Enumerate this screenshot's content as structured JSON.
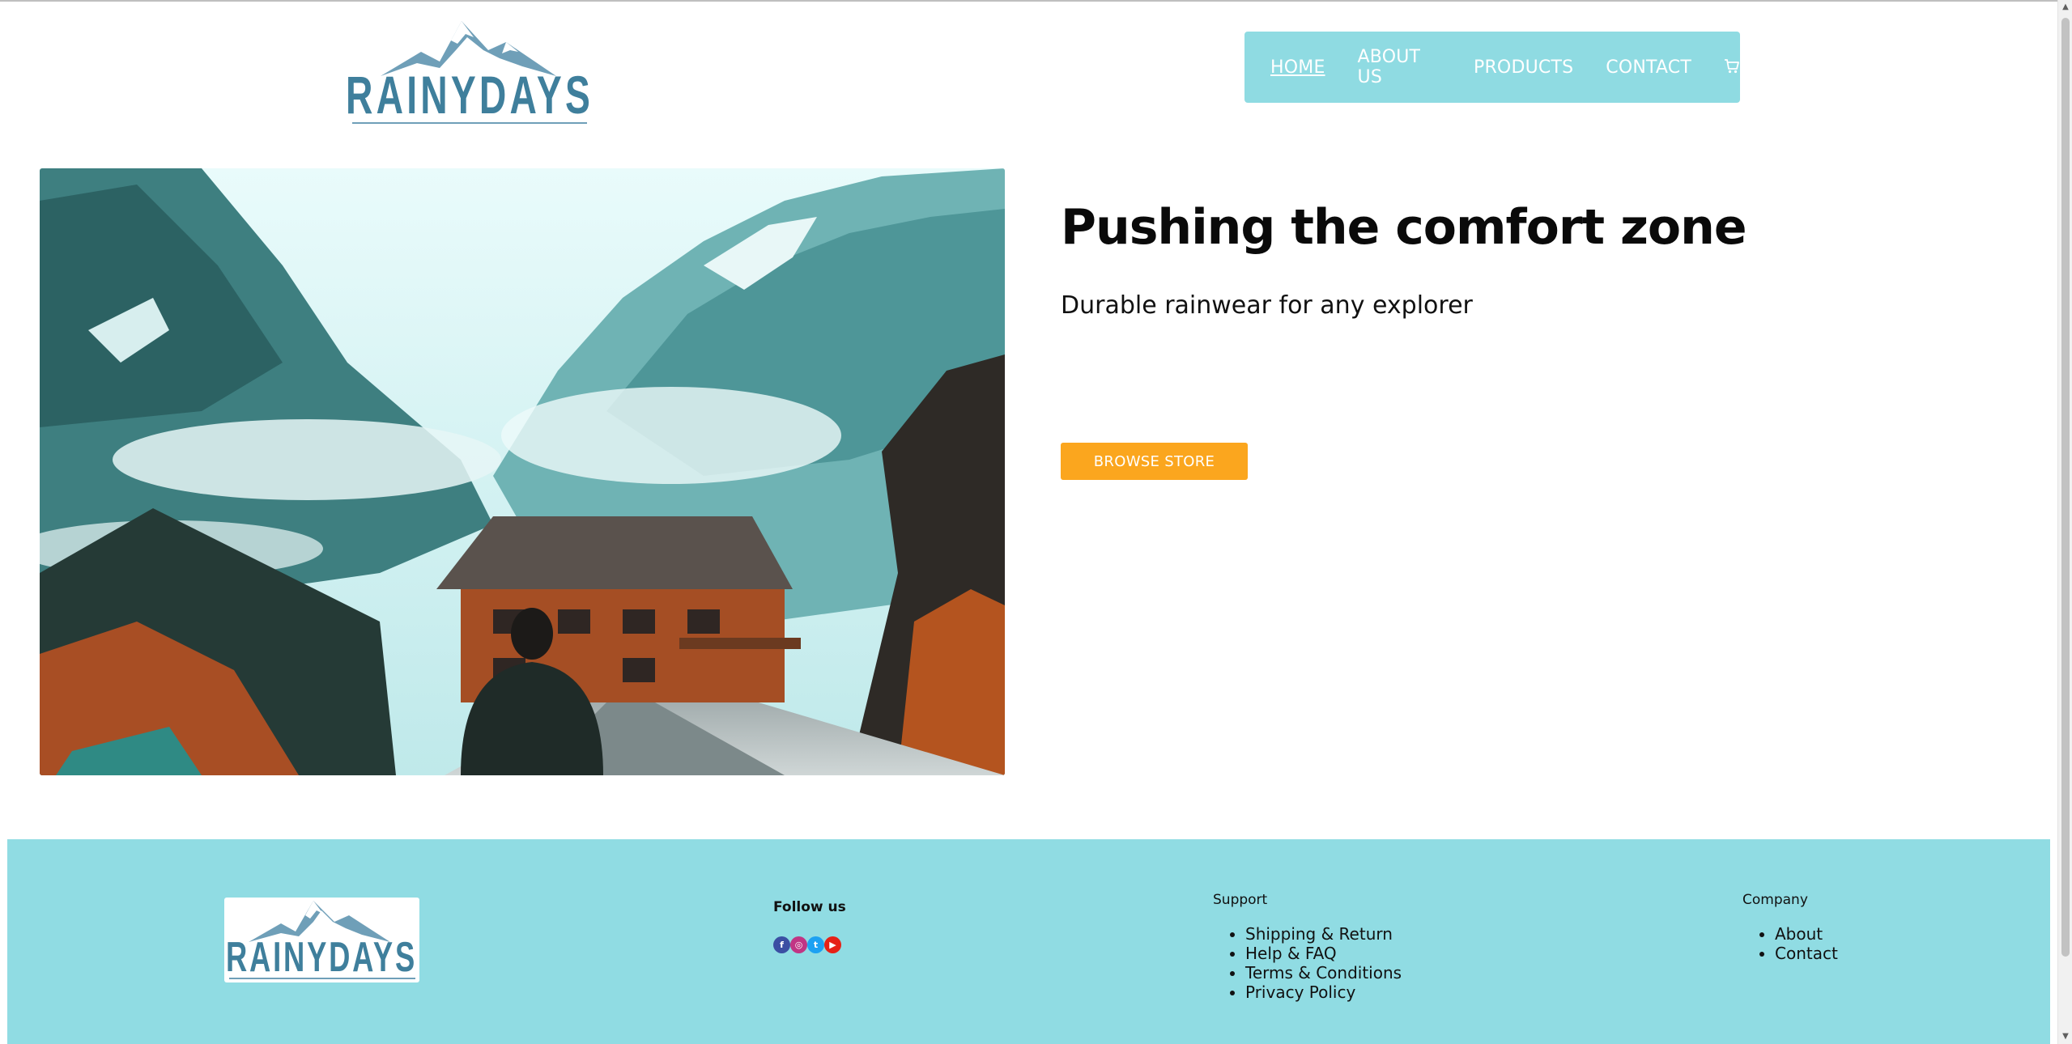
{
  "brand": {
    "name": "RAINYDAYS",
    "color": "#3f7f9c"
  },
  "nav": {
    "items": [
      {
        "label": "HOME",
        "active": true
      },
      {
        "label": "ABOUT US",
        "active": false
      },
      {
        "label": "PRODUCTS",
        "active": false
      },
      {
        "label": "CONTACT",
        "active": false
      }
    ],
    "cart_icon": "cart-icon",
    "background": "#8fdbe2"
  },
  "hero": {
    "title": "Pushing the comfort zone",
    "subtitle": "Durable rainwear for any explorer",
    "button_label": "BROWSE STORE",
    "button_color": "#fba61e",
    "image": "mountain-valley-chalet-photo"
  },
  "footer": {
    "background": "#90dce3",
    "follow_title": "Follow us",
    "social_icons": [
      {
        "name": "facebook-icon",
        "glyph": "f",
        "color": "#3b4fa3"
      },
      {
        "name": "instagram-icon",
        "glyph": "◎",
        "color": "#c13584"
      },
      {
        "name": "twitter-icon",
        "glyph": "t",
        "color": "#1da1f2"
      },
      {
        "name": "youtube-icon",
        "glyph": "▶",
        "color": "#e62117"
      }
    ],
    "support": {
      "title": "Support",
      "links": [
        "Shipping & Return",
        "Help & FAQ",
        "Terms & Conditions",
        "Privacy Policy"
      ]
    },
    "company": {
      "title": "Company",
      "links": [
        "About",
        "Contact"
      ]
    }
  }
}
